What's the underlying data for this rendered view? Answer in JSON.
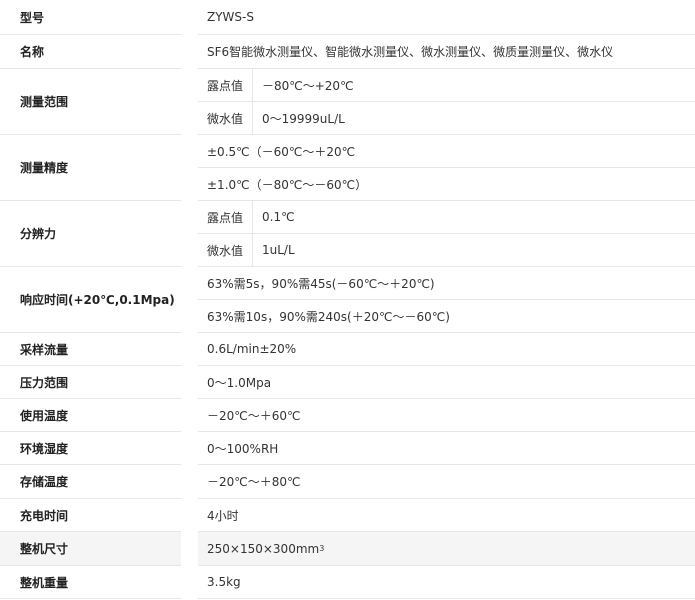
{
  "table": {
    "rows": [
      {
        "label": "型号",
        "value": "ZYWS-S"
      },
      {
        "label": "名称",
        "value": "SF6智能微水测量仪、智能微水测量仪、微水测量仪、微质量测量仪、微水仪"
      },
      {
        "label": "测量范围",
        "subs": [
          {
            "key": "露点值",
            "value": "－80℃～+20℃"
          },
          {
            "key": "微水值",
            "value": "0～19999uL/L"
          }
        ]
      },
      {
        "label": "测量精度",
        "subs": [
          {
            "value": "±0.5℃（－60℃～＋20℃"
          },
          {
            "value": "±1.0℃（－80℃～－60℃）"
          }
        ]
      },
      {
        "label": "分辨力",
        "subs": [
          {
            "key": "露点值",
            "value": "0.1℃"
          },
          {
            "key": "微水值",
            "value": "1uL/L"
          }
        ]
      },
      {
        "label": "响应时间(+20℃,0.1Mpa)",
        "subs": [
          {
            "value": "63%需5s，90%需45s(－60℃～＋20℃)"
          },
          {
            "value": "63%需10s，90%需240s(＋20℃～－60℃)"
          }
        ]
      },
      {
        "label": "采样流量",
        "value": "0.6L/min±20%"
      },
      {
        "label": "压力范围",
        "value": "0～1.0Mpa"
      },
      {
        "label": "使用温度",
        "value": "－20℃～＋60℃"
      },
      {
        "label": "环境湿度",
        "value": "0～100%RH"
      },
      {
        "label": "存储温度",
        "value": "－20℃～＋80℃"
      },
      {
        "label": "充电时间",
        "value": "4小时"
      },
      {
        "label": "整机尺寸",
        "value": "250×150×300mm",
        "value_sup": "3"
      },
      {
        "label": "整机重量",
        "value": "3.5kg"
      }
    ]
  }
}
